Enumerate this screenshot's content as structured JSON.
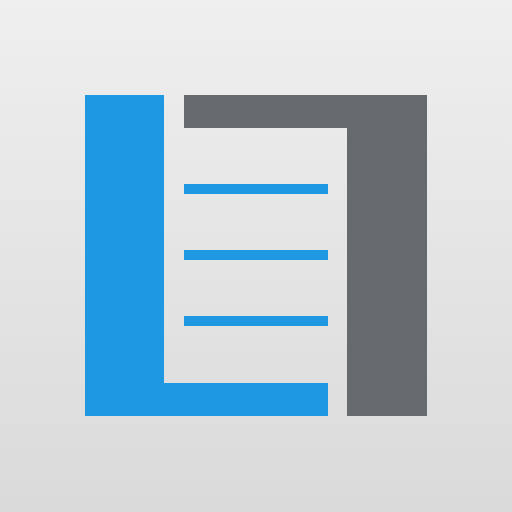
{
  "icon": {
    "name": "document-list-logo-icon",
    "colors": {
      "background_top": "#efefef",
      "background_bottom": "#dadada",
      "accent_blue": "#1e98e0",
      "accent_gray": "#666a6d"
    }
  }
}
